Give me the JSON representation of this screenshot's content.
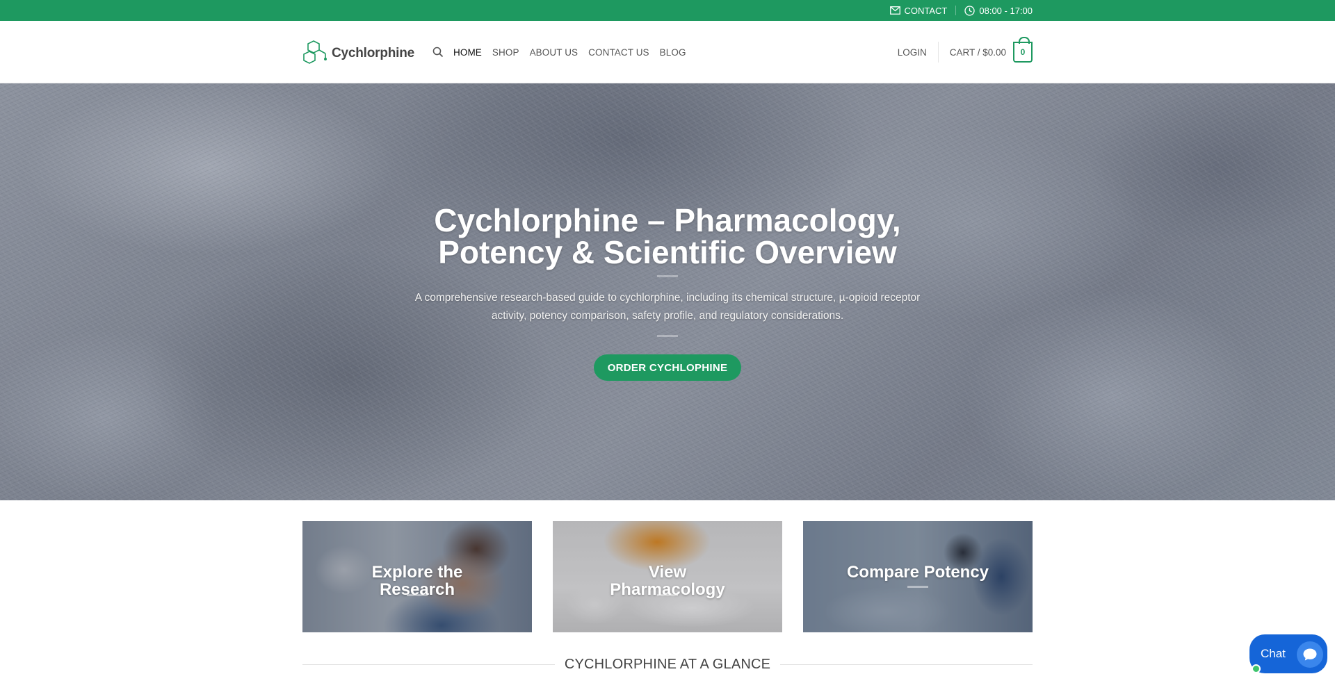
{
  "topbar": {
    "contact_label": "CONTACT",
    "hours_label": "08:00 - 17:00"
  },
  "header": {
    "logo_text": "Cychlorphine",
    "nav": [
      {
        "label": "HOME",
        "active": true
      },
      {
        "label": "SHOP",
        "active": false
      },
      {
        "label": "ABOUT US",
        "active": false
      },
      {
        "label": "CONTACT US",
        "active": false
      },
      {
        "label": "BLOG",
        "active": false
      }
    ],
    "login_label": "LOGIN",
    "cart_label": "CART / $0.00",
    "cart_count": "0"
  },
  "hero": {
    "title_line1": "Cychlorphine – Pharmacology,",
    "title_line2": "Potency & Scientific Overview",
    "subtitle": "A comprehensive research-based guide to cychlorphine, including its chemical structure, µ-opioid receptor activity, potency comparison, safety profile, and regulatory considerations.",
    "button_label": "ORDER CYCHLOPHINE"
  },
  "cards": [
    {
      "line1": "Explore the",
      "line2": "Research"
    },
    {
      "line1": "View",
      "line2": "Pharmacology"
    },
    {
      "line1": "Compare Potency",
      "line2": ""
    }
  ],
  "section": {
    "title": "CYCHLORPHINE AT A GLANCE"
  },
  "chat": {
    "label": "Chat"
  },
  "colors": {
    "brand_green": "#1e9960",
    "chat_blue": "#1565d8"
  }
}
